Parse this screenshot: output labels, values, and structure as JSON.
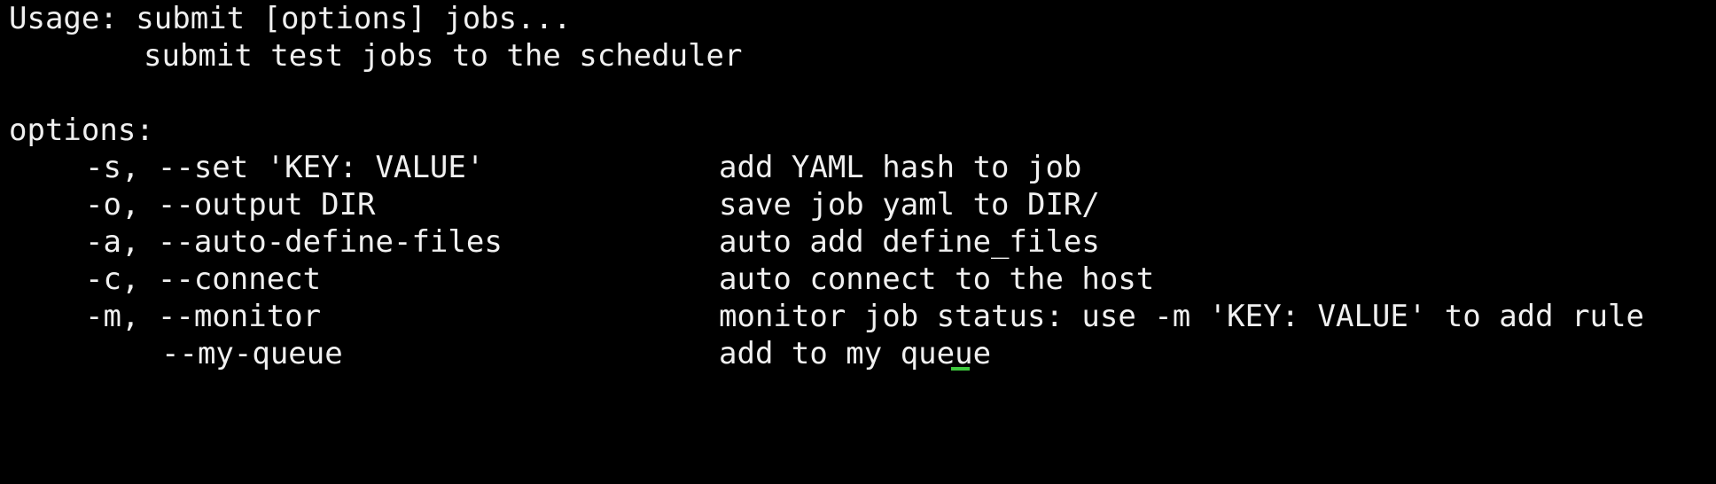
{
  "terminal": {
    "usage_line": "Usage: submit [options] jobs...",
    "description_line": "submit test jobs to the scheduler",
    "options_header": "options:",
    "options": [
      {
        "flag": "-s, --set 'KEY: VALUE'",
        "description": "add YAML hash to job"
      },
      {
        "flag": "-o, --output DIR",
        "description": "save job yaml to DIR/"
      },
      {
        "flag": "-a, --auto-define-files",
        "description": "auto add define_files"
      },
      {
        "flag": "-c, --connect",
        "description": "auto connect to the host"
      },
      {
        "flag": "-m, --monitor",
        "description": "monitor job status: use -m 'KEY: VALUE' to add rule"
      },
      {
        "flag": "--my-queue",
        "description": "add to my queue"
      }
    ],
    "cursor_color": "#3ec83e",
    "background_color": "#000000",
    "text_color": "#f0f0f0"
  }
}
